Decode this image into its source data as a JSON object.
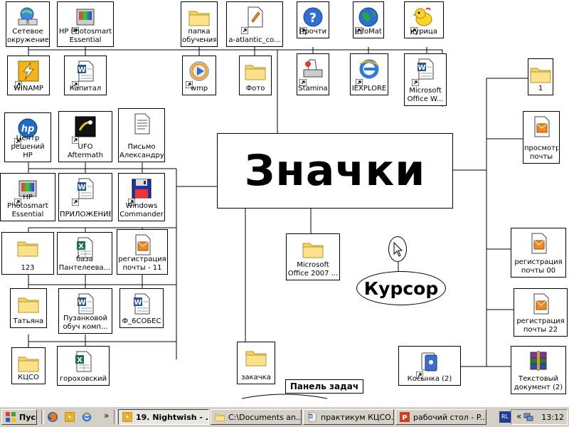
{
  "title": "Значки",
  "cursor_label": "Курсор",
  "taskbar_label": "Панель задач",
  "icons": [
    {
      "label": "Сетевое\nокружение",
      "icon": "network-icon",
      "shortcut": false
    },
    {
      "label": "HP Photosmart\nEssential",
      "icon": "hp-photosmart-icon",
      "shortcut": true
    },
    {
      "label": "папка\nобучения",
      "icon": "folder-icon",
      "shortcut": false
    },
    {
      "label": "a-atlantic_co...",
      "icon": "document-icon",
      "shortcut": true
    },
    {
      "label": "Прочти",
      "icon": "help-icon",
      "shortcut": true
    },
    {
      "label": "InfoMat",
      "icon": "globe-icon",
      "shortcut": true
    },
    {
      "label": "курица",
      "icon": "chick-icon",
      "shortcut": true
    },
    {
      "label": "WINAMP",
      "icon": "winamp-icon",
      "shortcut": true
    },
    {
      "label": "Капитал",
      "icon": "word-document-icon",
      "shortcut": true
    },
    {
      "label": "wmp",
      "icon": "media-player-icon",
      "shortcut": true
    },
    {
      "label": "Фото",
      "icon": "folder-icon",
      "shortcut": false
    },
    {
      "label": "Stamina",
      "icon": "stamina-icon",
      "shortcut": true
    },
    {
      "label": "IEXPLORE",
      "icon": "internet-explorer-icon",
      "shortcut": true
    },
    {
      "label": "Microsoft\nOffice W...",
      "icon": "word-document-icon",
      "shortcut": true
    },
    {
      "label": "1",
      "icon": "folder-icon",
      "shortcut": false
    },
    {
      "label": "Центр\nрешений HP",
      "icon": "hp-icon",
      "shortcut": true
    },
    {
      "label": "UFO Aftermath",
      "icon": "ufo-icon",
      "shortcut": true
    },
    {
      "label": "Письмо\nАлександру",
      "icon": "text-document-icon",
      "shortcut": false
    },
    {
      "label": "просмотр\nпочты",
      "icon": "mail-view-icon",
      "shortcut": false
    },
    {
      "label": "HP Photosmart\nEssential",
      "icon": "hp-photosmart-icon",
      "shortcut": true
    },
    {
      "label": "ПРИЛОЖЕНИЕ",
      "icon": "word-document-icon",
      "shortcut": true
    },
    {
      "label": "Windows\nCommander",
      "icon": "floppy-icon",
      "shortcut": true
    },
    {
      "label": "123",
      "icon": "folder-icon",
      "shortcut": false
    },
    {
      "label": "база\nПантелеева...",
      "icon": "excel-document-icon",
      "shortcut": false
    },
    {
      "label": "регистрация\nпочты - 11",
      "icon": "mail-view-icon",
      "shortcut": false
    },
    {
      "label": "Microsoft\nOffice 2007 ...",
      "icon": "folder-icon",
      "shortcut": false
    },
    {
      "label": "регистрация\nпочты 00",
      "icon": "mail-view-icon",
      "shortcut": false
    },
    {
      "label": "Татьяна",
      "icon": "folder-icon",
      "shortcut": false
    },
    {
      "label": "Пузанковой\nобуч комп...",
      "icon": "word-document-icon",
      "shortcut": false
    },
    {
      "label": "Ф_6СОБЕС",
      "icon": "word-document-icon",
      "shortcut": false
    },
    {
      "label": "регистрация\nпочты 22",
      "icon": "mail-view-icon",
      "shortcut": false
    },
    {
      "label": "КЦСО",
      "icon": "folder-icon",
      "shortcut": false
    },
    {
      "label": "гороховский",
      "icon": "excel-document-icon",
      "shortcut": false
    },
    {
      "label": "закачка",
      "icon": "folder-icon",
      "shortcut": false
    },
    {
      "label": "Косынка (2)",
      "icon": "solitaire-icon",
      "shortcut": true
    },
    {
      "label": "Текстовый\nдокумент (2)",
      "icon": "winrar-icon",
      "shortcut": false
    }
  ],
  "taskbar": {
    "start_label": "Пуск",
    "quick_launch": [
      {
        "icon": "firefox-icon"
      },
      {
        "icon": "winamp-icon"
      },
      {
        "icon": "internet-explorer-icon"
      }
    ],
    "overflow_label": "»",
    "tasks": [
      {
        "label": "19. Nightwish - ...",
        "icon": "winamp-icon",
        "active": true
      },
      {
        "label": "C:\\Documents an...",
        "icon": "folder-icon",
        "active": false
      },
      {
        "label": "практикум КЦСО...",
        "icon": "word-document-icon",
        "active": false
      },
      {
        "label": "рабочий стол - P...",
        "icon": "powerpoint-icon",
        "active": false
      }
    ],
    "lang": "RL",
    "tray_chevron": "«",
    "clock": "13:12"
  },
  "colors": {
    "taskbar": "#d4d0c8",
    "folder": "#f4d46a",
    "link_arrow": "#000000"
  }
}
